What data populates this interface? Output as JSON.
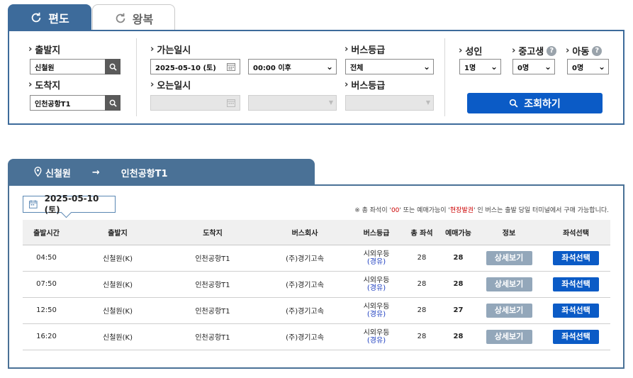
{
  "tabs": {
    "oneway": "편도",
    "roundtrip": "왕복"
  },
  "search": {
    "departure_label": "출발지",
    "departure_value": "신철원",
    "arrival_label": "도착지",
    "arrival_value": "인천공항T1",
    "go_date_label": "가는일시",
    "go_date_value": "2025-05-10 (토)",
    "go_time_value": "00:00 이후",
    "return_date_label": "오는일시",
    "bus_grade_label_1": "버스등급",
    "bus_grade_value_1": "전체",
    "bus_grade_label_2": "버스등급",
    "adult_label": "성인",
    "adult_value": "1명",
    "teen_label": "중고생",
    "teen_value": "0명",
    "child_label": "아동",
    "child_value": "0명",
    "help_mark": "?",
    "query_button": "조회하기"
  },
  "route": {
    "from": "신철원",
    "arrow": "→",
    "to": "인천공항T1"
  },
  "results": {
    "date": "2025-05-10 (토)",
    "notice_prefix": "※ 총 좌석이 '",
    "notice_zero": "00",
    "notice_mid": "' 또는 예매가능이 '",
    "notice_onsite": "현장발권",
    "notice_suffix": "' 인 버스는 출발 당일 터미널에서 구매 가능합니다.",
    "headers": [
      "출발시간",
      "출발지",
      "도착지",
      "버스회사",
      "버스등급",
      "총 좌석",
      "예매가능",
      "정보",
      "좌석선택"
    ],
    "rows": [
      {
        "time": "04:50",
        "from": "신철원(K)",
        "to": "인천공항T1",
        "company": "(주)경기고속",
        "grade": "시외우등",
        "grade_sub": "(경유)",
        "seats": "28",
        "available": "28",
        "detail": "상세보기",
        "select": "좌석선택"
      },
      {
        "time": "07:50",
        "from": "신철원(K)",
        "to": "인천공항T1",
        "company": "(주)경기고속",
        "grade": "시외우등",
        "grade_sub": "(경유)",
        "seats": "28",
        "available": "28",
        "detail": "상세보기",
        "select": "좌석선택"
      },
      {
        "time": "12:50",
        "from": "신철원(K)",
        "to": "인천공항T1",
        "company": "(주)경기고속",
        "grade": "시외우등",
        "grade_sub": "(경유)",
        "seats": "28",
        "available": "27",
        "detail": "상세보기",
        "select": "좌석선택"
      },
      {
        "time": "16:20",
        "from": "신철원(K)",
        "to": "인천공항T1",
        "company": "(주)경기고속",
        "grade": "시외우등",
        "grade_sub": "(경유)",
        "seats": "28",
        "available": "28",
        "detail": "상세보기",
        "select": "좌석선택"
      }
    ]
  },
  "colors": {
    "primary": "#3d6b9b",
    "button_blue": "#0b5bc6",
    "detail_gray": "#93a7ba"
  }
}
